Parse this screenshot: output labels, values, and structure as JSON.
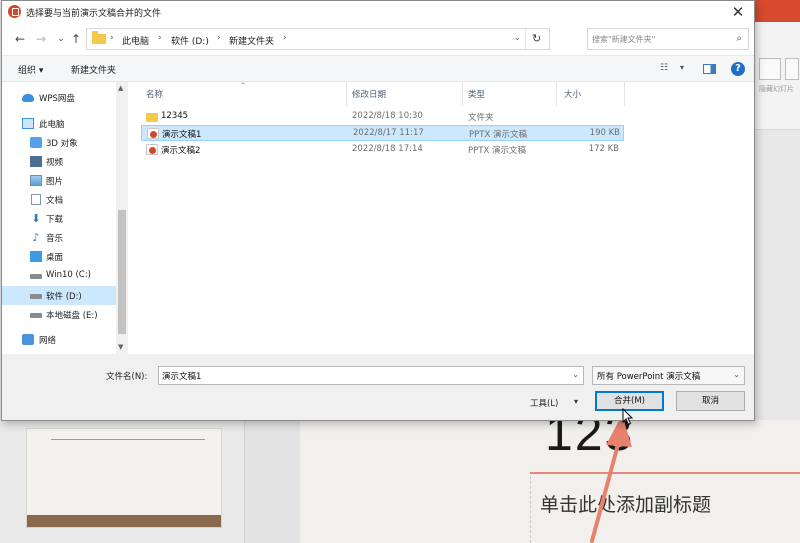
{
  "dialog": {
    "title": "选择要与当前演示文稿合并的文件",
    "close_glyph": "✕"
  },
  "nav": {
    "back_glyph": "←",
    "forward_glyph": "→",
    "recent_glyph": "⌄",
    "up_glyph": "↑"
  },
  "address": {
    "crumbs": [
      "此电脑",
      "软件 (D:)",
      "新建文件夹"
    ],
    "separator": "›",
    "dropdown_glyph": "⌄",
    "refresh_glyph": "↻"
  },
  "search": {
    "placeholder": "搜索\"新建文件夹\"",
    "icon_glyph": "⌕"
  },
  "toolbar": {
    "organize": "组织 ▾",
    "new_folder": "新建文件夹",
    "view_glyph": "☷",
    "view_dd": "▾",
    "help": "?"
  },
  "sidebar": {
    "items": [
      {
        "label": "WPS网盘",
        "icon": "cloud-icon"
      },
      {
        "label": "此电脑",
        "icon": "computer-icon"
      },
      {
        "label": "3D 对象",
        "icon": "3d-objects-icon"
      },
      {
        "label": "视频",
        "icon": "video-icon"
      },
      {
        "label": "图片",
        "icon": "pictures-icon"
      },
      {
        "label": "文档",
        "icon": "documents-icon"
      },
      {
        "label": "下载",
        "icon": "download-icon"
      },
      {
        "label": "音乐",
        "icon": "music-icon"
      },
      {
        "label": "桌面",
        "icon": "desktop-icon"
      },
      {
        "label": "Win10 (C:)",
        "icon": "drive-icon"
      },
      {
        "label": "软件 (D:)",
        "icon": "drive-icon",
        "selected": true
      },
      {
        "label": "本地磁盘 (E:)",
        "icon": "drive-icon"
      },
      {
        "label": "网络",
        "icon": "network-icon"
      }
    ],
    "download_glyph": "⬇",
    "music_glyph": "♪"
  },
  "filelist": {
    "columns": [
      "名称",
      "修改日期",
      "类型",
      "大小"
    ],
    "sort_glyph": "^",
    "rows": [
      {
        "name": "12345",
        "date": "2022/8/18 10:30",
        "type": "文件夹",
        "size": "",
        "kind": "folder"
      },
      {
        "name": "演示文稿1",
        "date": "2022/8/17 11:17",
        "type": "PPTX 演示文稿",
        "size": "190 KB",
        "kind": "pptx",
        "selected": true
      },
      {
        "name": "演示文稿2",
        "date": "2022/8/18 17:14",
        "type": "PPTX 演示文稿",
        "size": "172 KB",
        "kind": "pptx"
      }
    ]
  },
  "bottom": {
    "filename_label": "文件名(N):",
    "filename_value": "演示文稿1",
    "filetype_value": "所有 PowerPoint 演示文稿",
    "dd_glyph": "⌄",
    "tools_label": "工具(L)",
    "tools_dd": "▾",
    "merge_button": "合并(M)",
    "cancel_button": "取消"
  },
  "background": {
    "ribbon_text": "隐藏幻灯片",
    "slide_number": "123",
    "slide_subtitle": "单击此处添加副标题"
  },
  "colors": {
    "accent": "#0078d7",
    "selection": "#cce8ff",
    "pptx": "#d24726",
    "arrow": "#e8826c"
  }
}
